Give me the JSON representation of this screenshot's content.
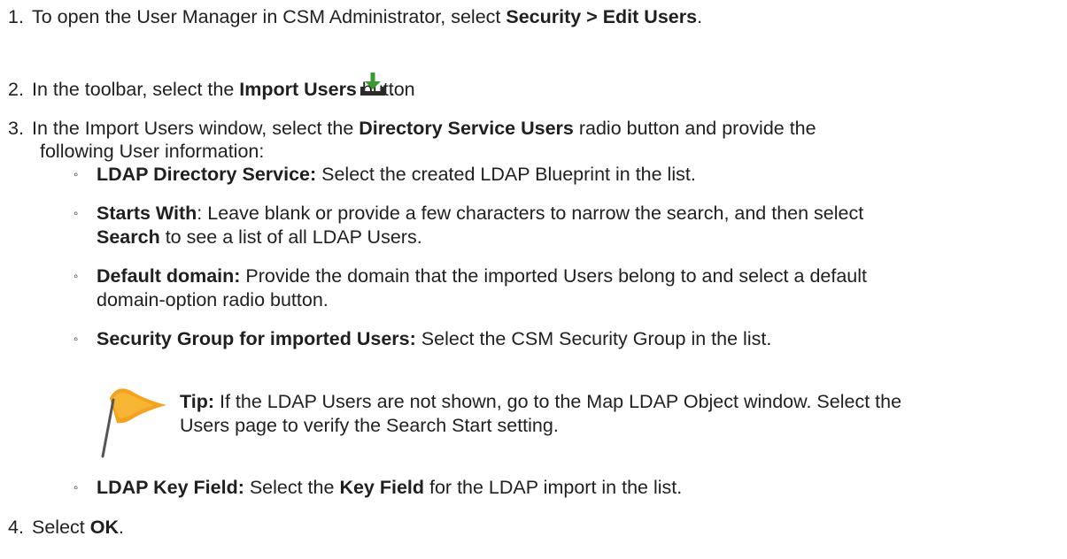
{
  "steps": {
    "s1": {
      "num": "1.",
      "pre": "To open the User Manager in CSM Administrator, select ",
      "bold": "Security > Edit Users",
      "post": "."
    },
    "s2": {
      "num": "2.",
      "pre": "In the toolbar, select the ",
      "bold": "Import Users",
      "post": " button",
      "end": "."
    },
    "s3": {
      "num": "3.",
      "pre": "In the Import Users window, select the ",
      "bold": "Directory Service Users",
      "post": " radio button and provide the",
      "line2": "following User information:"
    },
    "s4": {
      "num": "4.",
      "pre": "Select ",
      "bold": "OK",
      "post": "."
    }
  },
  "bullets": {
    "b1": {
      "bold": "LDAP Directory Service:",
      "text": " Select the created LDAP Blueprint in the list."
    },
    "b2": {
      "bold": "Starts With",
      "text": ": Leave blank or provide a few characters to narrow the search, and then select",
      "bold2": "Search",
      "text2": " to see a list of all LDAP Users."
    },
    "b3": {
      "bold": "Default domain:",
      "text": " Provide the domain that the imported Users belong to and select a default",
      "line2": "domain-option radio button."
    },
    "b4": {
      "bold": "Security Group for imported Users:",
      "text": " Select the CSM Security Group in the list."
    },
    "b5": {
      "bold": "LDAP Key Field:",
      "text": " Select the ",
      "bold2": "Key Field",
      "text2": " for the LDAP import in the list."
    }
  },
  "tip": {
    "label": "Tip:",
    "text": " If the LDAP Users are not shown, go to the Map LDAP Object window. Select the",
    "line2": "Users page to verify the Search Start setting."
  },
  "bullet_glyph": "◦",
  "icons": {
    "import": "import-users-icon",
    "tip": "flag-icon"
  },
  "colors": {
    "import_arrow": "#3a9a2e",
    "import_tray": "#2b2b2b",
    "flag": "#f6a21a"
  }
}
